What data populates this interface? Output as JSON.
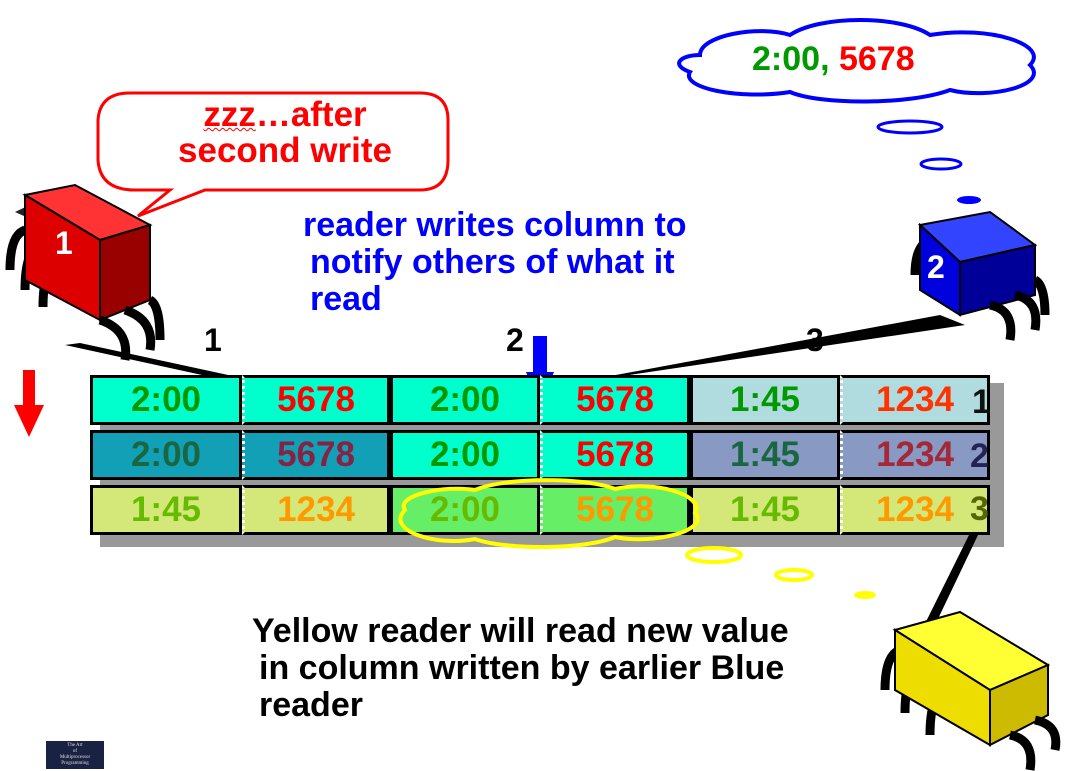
{
  "speech": {
    "line1_squiggle": "zzz",
    "line1_rest": "…after",
    "line2": "second write"
  },
  "thought": {
    "time": "2:00",
    "sep": ",",
    "value": "5678"
  },
  "reader_labels": {
    "red": "1",
    "blue": "2"
  },
  "blue_note": {
    "line1": "reader writes column to",
    "line2": "notify others of what it",
    "line3": "read"
  },
  "columns": [
    "1",
    "2",
    "3"
  ],
  "rows": [
    {
      "label": "1",
      "cells": [
        "2:00",
        "5678",
        "2:00",
        "5678",
        "1:45",
        "1234"
      ]
    },
    {
      "label": "2",
      "cells": [
        "2:00",
        "5678",
        "2:00",
        "5678",
        "1:45",
        "1234"
      ]
    },
    {
      "label": "3",
      "cells": [
        "1:45",
        "1234",
        "2:00",
        "5678",
        "1:45",
        "1234"
      ]
    }
  ],
  "bottom_note": {
    "line1": "Yellow reader will read new value",
    "line2": "in column written by earlier Blue",
    "line3": "reader"
  },
  "logo": {
    "line1": "The Art",
    "line2": "of",
    "line3": "Multiprocessor",
    "line4": "Programming"
  },
  "colors": {
    "red": "#ff0000",
    "blue": "#0000ff",
    "green": "#009900",
    "yellow": "#ffff00",
    "cyan": "#00ffcc"
  }
}
